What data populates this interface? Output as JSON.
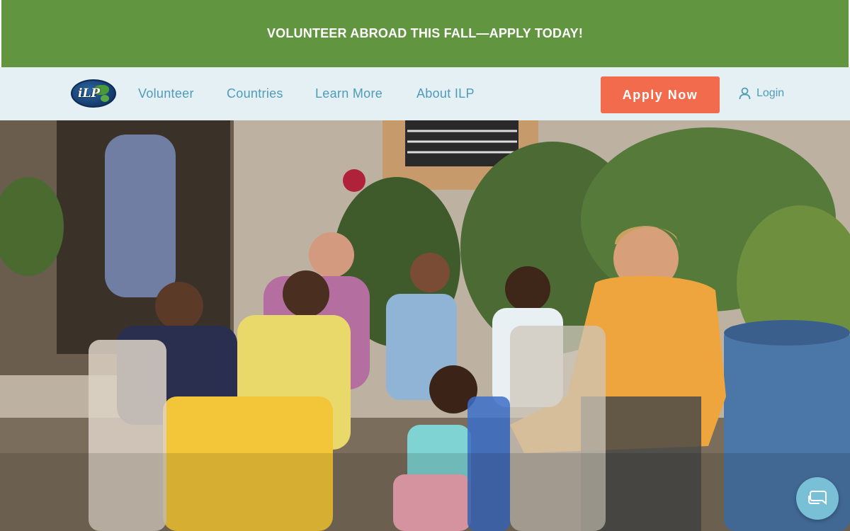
{
  "announcement": {
    "text": "VOLUNTEER ABROAD THIS FALL—APPLY TODAY!"
  },
  "nav": {
    "logo_text": "iLP",
    "links": [
      {
        "label": "Volunteer"
      },
      {
        "label": "Countries"
      },
      {
        "label": "Learn More"
      },
      {
        "label": "About ILP"
      }
    ],
    "apply_label": "Apply Now",
    "login_label": "Login",
    "login_icon": "user-icon"
  },
  "hero": {
    "image": "group-of-volunteers-and-children-photo"
  },
  "chat": {
    "icon": "chat-bubble-icon"
  },
  "colors": {
    "announcement_bg": "#629540",
    "nav_bg": "#e4f0f4",
    "nav_link": "#4f9bb8",
    "apply_bg": "#f26b4d",
    "chat_bg": "#79c0d6"
  }
}
